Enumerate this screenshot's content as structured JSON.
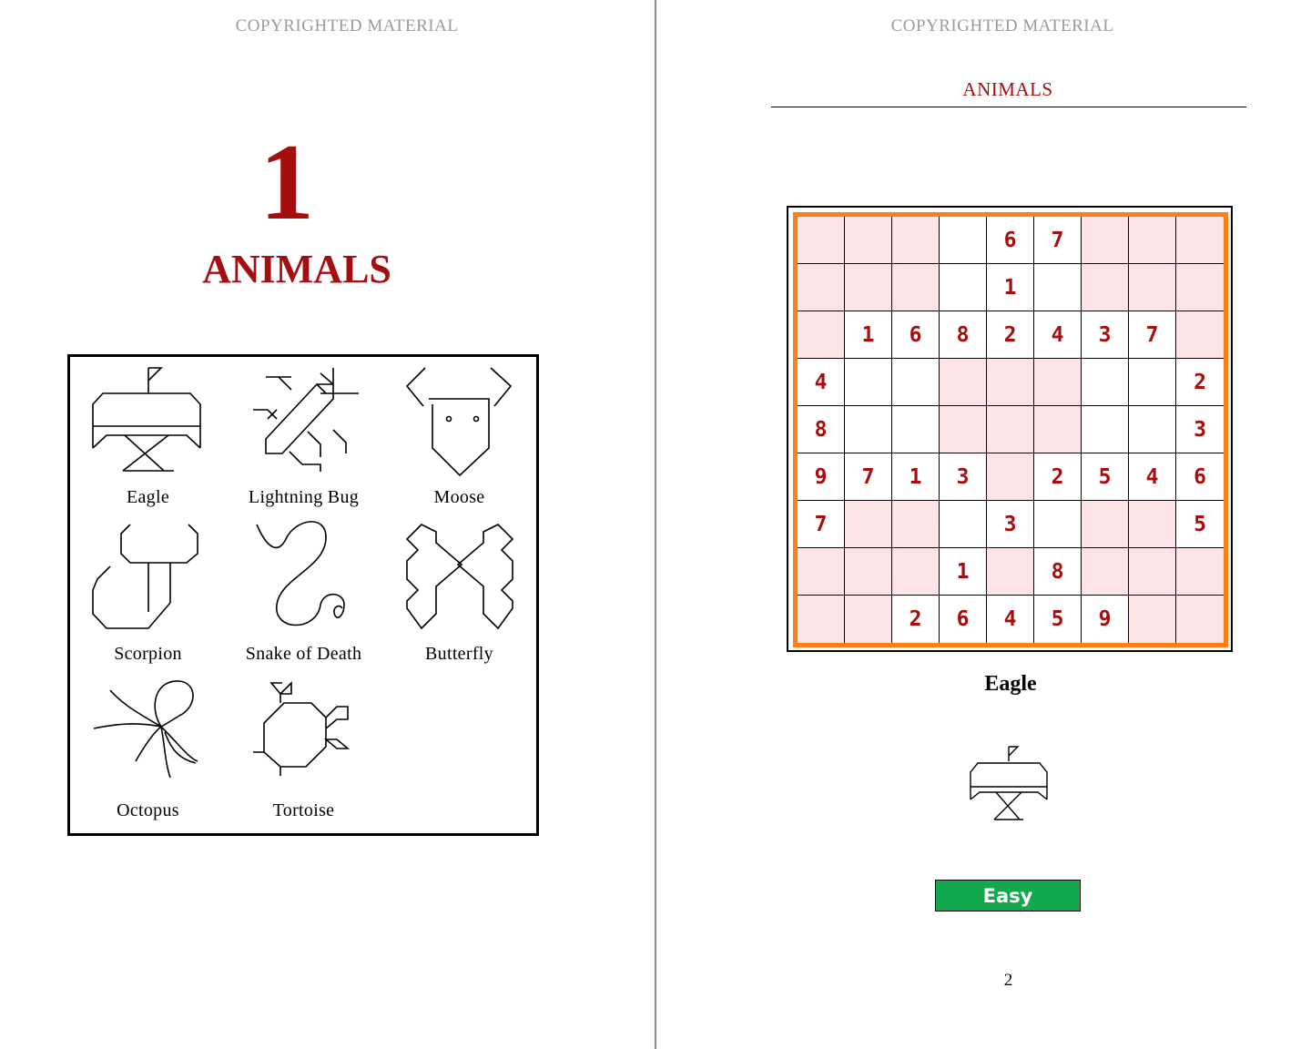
{
  "left_page": {
    "header": "COPYRIGHTED MATERIAL",
    "chapter_number": "1",
    "chapter_title": "ANIMALS",
    "puzzles": [
      {
        "label": "Eagle",
        "icon": "eagle-icon"
      },
      {
        "label": "Lightning Bug",
        "icon": "lightning-bug-icon"
      },
      {
        "label": "Moose",
        "icon": "moose-icon"
      },
      {
        "label": "Scorpion",
        "icon": "scorpion-icon"
      },
      {
        "label": "Snake of Death",
        "icon": "snake-icon"
      },
      {
        "label": "Butterfly",
        "icon": "butterfly-icon"
      },
      {
        "label": "Octopus",
        "icon": "octopus-icon"
      },
      {
        "label": "Tortoise",
        "icon": "tortoise-icon"
      }
    ]
  },
  "right_page": {
    "header": "COPYRIGHTED MATERIAL",
    "running_head": "ANIMALS",
    "puzzle_title": "Eagle",
    "difficulty": "Easy",
    "page_number": "2",
    "colors": {
      "accent": "#a50e0e",
      "grid_border": "#ff7f17",
      "shade": "#fde4e7",
      "difficulty": "#12a84e"
    },
    "grid": [
      [
        "",
        "",
        "",
        "",
        "6",
        "7",
        "",
        "",
        ""
      ],
      [
        "",
        "",
        "",
        "",
        "1",
        "",
        "",
        "",
        ""
      ],
      [
        "",
        "1",
        "6",
        "8",
        "2",
        "4",
        "3",
        "7",
        ""
      ],
      [
        "4",
        "",
        "",
        "",
        "",
        "",
        "",
        "",
        "2"
      ],
      [
        "8",
        "",
        "",
        "",
        "",
        "",
        "",
        "",
        "3"
      ],
      [
        "9",
        "7",
        "1",
        "3",
        "",
        "2",
        "5",
        "4",
        "6"
      ],
      [
        "7",
        "",
        "",
        "",
        "3",
        "",
        "",
        "",
        "5"
      ],
      [
        "",
        "",
        "",
        "1",
        "",
        "8",
        "",
        "",
        ""
      ],
      [
        "",
        "",
        "2",
        "6",
        "4",
        "5",
        "9",
        "",
        ""
      ]
    ],
    "shaded": [
      [
        1,
        1,
        1,
        0,
        0,
        0,
        1,
        1,
        1
      ],
      [
        1,
        1,
        1,
        0,
        0,
        0,
        1,
        1,
        1
      ],
      [
        1,
        0,
        0,
        0,
        0,
        0,
        0,
        0,
        1
      ],
      [
        0,
        0,
        0,
        1,
        1,
        1,
        0,
        0,
        0
      ],
      [
        0,
        0,
        0,
        1,
        1,
        1,
        0,
        0,
        0
      ],
      [
        0,
        0,
        0,
        0,
        1,
        0,
        0,
        0,
        0
      ],
      [
        0,
        1,
        1,
        0,
        0,
        0,
        1,
        1,
        0
      ],
      [
        1,
        1,
        1,
        0,
        1,
        0,
        1,
        1,
        1
      ],
      [
        1,
        1,
        0,
        0,
        0,
        0,
        0,
        1,
        1
      ]
    ]
  }
}
